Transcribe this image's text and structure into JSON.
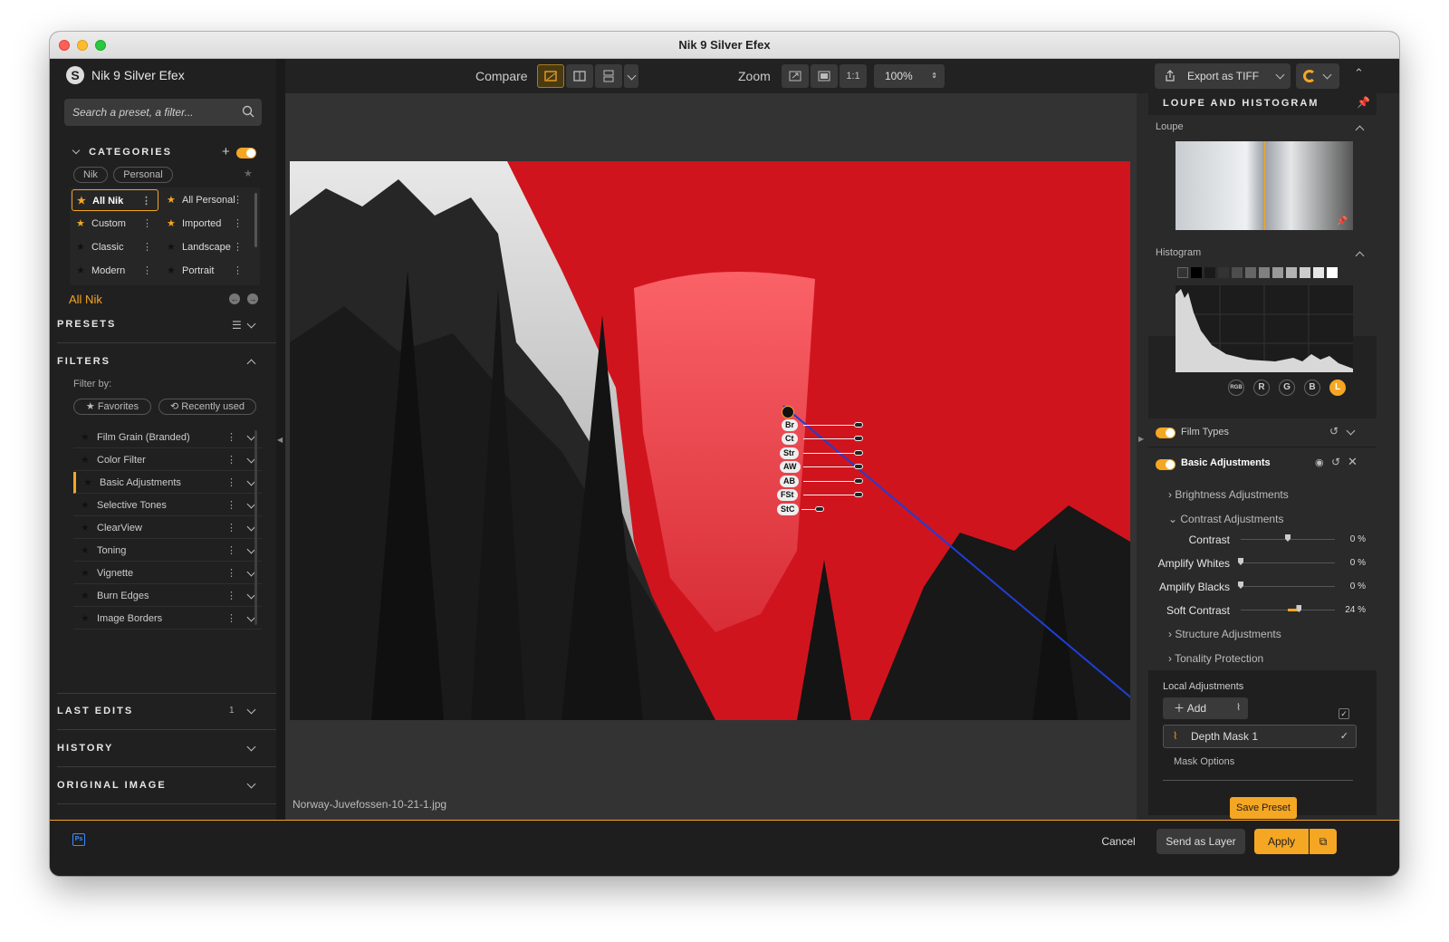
{
  "window": {
    "title": "Nik 9 Silver Efex"
  },
  "left": {
    "app_name": "Nik 9 Silver Efex",
    "search_placeholder": "Search a preset, a filter...",
    "categories": {
      "title": "CATEGORIES",
      "add": "+",
      "tabs": [
        "Nik",
        "Personal"
      ],
      "items": [
        {
          "label": "All Nik",
          "star": "gold"
        },
        {
          "label": "All Personal",
          "star": "gold"
        },
        {
          "label": "Custom",
          "star": "gold"
        },
        {
          "label": "Imported",
          "star": "gold"
        },
        {
          "label": "Classic",
          "star": "dark"
        },
        {
          "label": "Landscape",
          "star": "dark"
        },
        {
          "label": "Modern",
          "star": "dark"
        },
        {
          "label": "Portrait",
          "star": "dark"
        }
      ],
      "current": "All Nik"
    },
    "presets_title": "PRESETS",
    "filters": {
      "title": "FILTERS",
      "filter_by": "Filter by:",
      "favorites": "Favorites",
      "recently_used": "Recently used",
      "items": [
        "Film Grain (Branded)",
        "Color Filter",
        "Basic Adjustments",
        "Selective Tones",
        "ClearView",
        "Toning",
        "Vignette",
        "Burn Edges",
        "Image Borders"
      ]
    },
    "last_edits": {
      "title": "LAST EDITS",
      "count": "1"
    },
    "history_title": "HISTORY",
    "original_title": "ORIGINAL IMAGE"
  },
  "toolbar": {
    "compare": "Compare",
    "zoom": "Zoom",
    "one_to_one": "1:1",
    "zoom_value": "100%"
  },
  "image": {
    "filename": "Norway-Juvefossen-10-21-1.jpg",
    "control_points": [
      "Br",
      "Ct",
      "Str",
      "AW",
      "AB",
      "FSt",
      "StC"
    ]
  },
  "right": {
    "export_label": "Export as TIFF",
    "loupe_histogram_title": "LOUPE AND HISTOGRAM",
    "loupe_label": "Loupe",
    "histogram_label": "Histogram",
    "channels": [
      "RGB",
      "R",
      "G",
      "B",
      "L"
    ],
    "film_types": "Film Types",
    "basic_adjustments": "Basic Adjustments",
    "brightness": "Brightness Adjustments",
    "contrast_adj": "Contrast Adjustments",
    "sliders": [
      {
        "label": "Contrast",
        "value": "0 %",
        "fraction": 0.5
      },
      {
        "label": "Amplify Whites",
        "value": "0 %",
        "fraction": 0.0
      },
      {
        "label": "Amplify Blacks",
        "value": "0 %",
        "fraction": 0.0
      },
      {
        "label": "Soft Contrast",
        "value": "24 %",
        "fraction": 0.62
      }
    ],
    "structure": "Structure Adjustments",
    "tonality": "Tonality Protection",
    "local_adjustments": "Local Adjustments",
    "add_label": "Add",
    "depth_mask": "Depth Mask 1",
    "mask_options": "Mask Options",
    "save_preset": "Save Preset"
  },
  "bottom": {
    "cancel": "Cancel",
    "send_layer": "Send as Layer",
    "apply": "Apply",
    "ps": "Ps"
  },
  "colors": {
    "accent": "#f5a623",
    "mask": "#d0141e",
    "link": "#1e3fd6"
  }
}
